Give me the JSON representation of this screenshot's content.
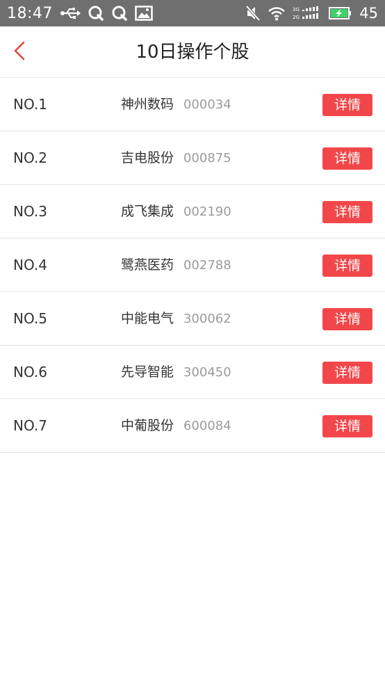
{
  "status_bar": {
    "time": "18:47",
    "battery": "45",
    "icons_left": [
      "usb-icon",
      "q-app-icon",
      "q-app-icon",
      "gallery-icon"
    ],
    "icons_right": [
      "mute-icon",
      "wifi-icon",
      "signal-icon",
      "battery-charging-icon"
    ],
    "network_label_top": "3G",
    "network_label_bottom": "2G"
  },
  "header": {
    "title": "10日操作个股",
    "back_icon": "chevron-left-icon",
    "accent_color": "#e0463f"
  },
  "stocks": [
    {
      "rank": "NO.1",
      "name": "神州数码",
      "code": "000034",
      "detail_label": "详情"
    },
    {
      "rank": "NO.2",
      "name": "吉电股份",
      "code": "000875",
      "detail_label": "详情"
    },
    {
      "rank": "NO.3",
      "name": "成飞集成",
      "code": "002190",
      "detail_label": "详情"
    },
    {
      "rank": "NO.4",
      "name": "鹭燕医药",
      "code": "002788",
      "detail_label": "详情"
    },
    {
      "rank": "NO.5",
      "name": "中能电气",
      "code": "300062",
      "detail_label": "详情"
    },
    {
      "rank": "NO.6",
      "name": "先导智能",
      "code": "300450",
      "detail_label": "详情"
    },
    {
      "rank": "NO.7",
      "name": "中葡股份",
      "code": "600084",
      "detail_label": "详情"
    }
  ],
  "colors": {
    "button_bg": "#f2474a",
    "code_text": "#9b9b9b",
    "status_bar_bg": "#6f6f6f"
  }
}
